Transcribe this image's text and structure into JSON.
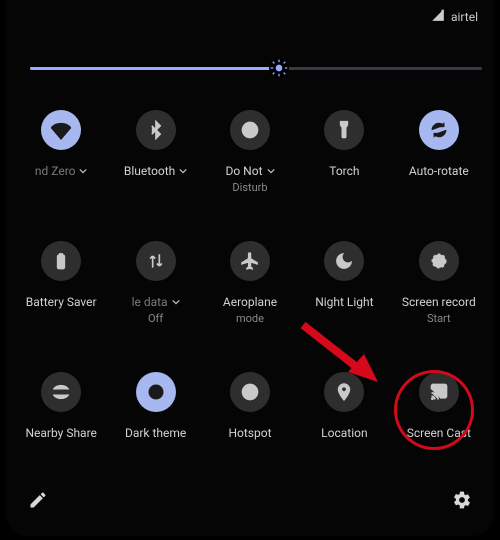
{
  "status": {
    "carrier": "airtel"
  },
  "brightness": {
    "value_pct": 55
  },
  "tiles": [
    {
      "id": "wifi",
      "label": "nd Zero",
      "sub": "",
      "active": true,
      "chevron": true
    },
    {
      "id": "bluetooth",
      "label": "Bluetooth",
      "sub": "",
      "active": false,
      "chevron": true
    },
    {
      "id": "dnd",
      "label": "Do Not",
      "sub": "Disturb",
      "active": false,
      "chevron": true
    },
    {
      "id": "torch",
      "label": "Torch",
      "sub": "",
      "active": false,
      "chevron": false
    },
    {
      "id": "autorotate",
      "label": "Auto-rotate",
      "sub": "",
      "active": true,
      "chevron": false
    },
    {
      "id": "battery",
      "label": "Battery Saver",
      "sub": "",
      "active": false,
      "chevron": false
    },
    {
      "id": "mobiledata",
      "label": "le data",
      "sub": "Off",
      "active": false,
      "chevron": true
    },
    {
      "id": "airplane",
      "label": "Aeroplane",
      "sub": "mode",
      "active": false,
      "chevron": false
    },
    {
      "id": "nightlight",
      "label": "Night Light",
      "sub": "",
      "active": false,
      "chevron": false
    },
    {
      "id": "screenrecord",
      "label": "Screen record",
      "sub": "Start",
      "active": false,
      "chevron": false
    },
    {
      "id": "nearbyshare",
      "label": "Nearby Share",
      "sub": "",
      "active": false,
      "chevron": false
    },
    {
      "id": "darktheme",
      "label": "Dark theme",
      "sub": "",
      "active": true,
      "chevron": false
    },
    {
      "id": "hotspot",
      "label": "Hotspot",
      "sub": "",
      "active": false,
      "chevron": false
    },
    {
      "id": "location",
      "label": "Location",
      "sub": "",
      "active": false,
      "chevron": false
    },
    {
      "id": "screencast",
      "label": "Screen Cast",
      "sub": "",
      "active": false,
      "chevron": false
    }
  ],
  "annotation": {
    "target_tile": "screencast"
  }
}
